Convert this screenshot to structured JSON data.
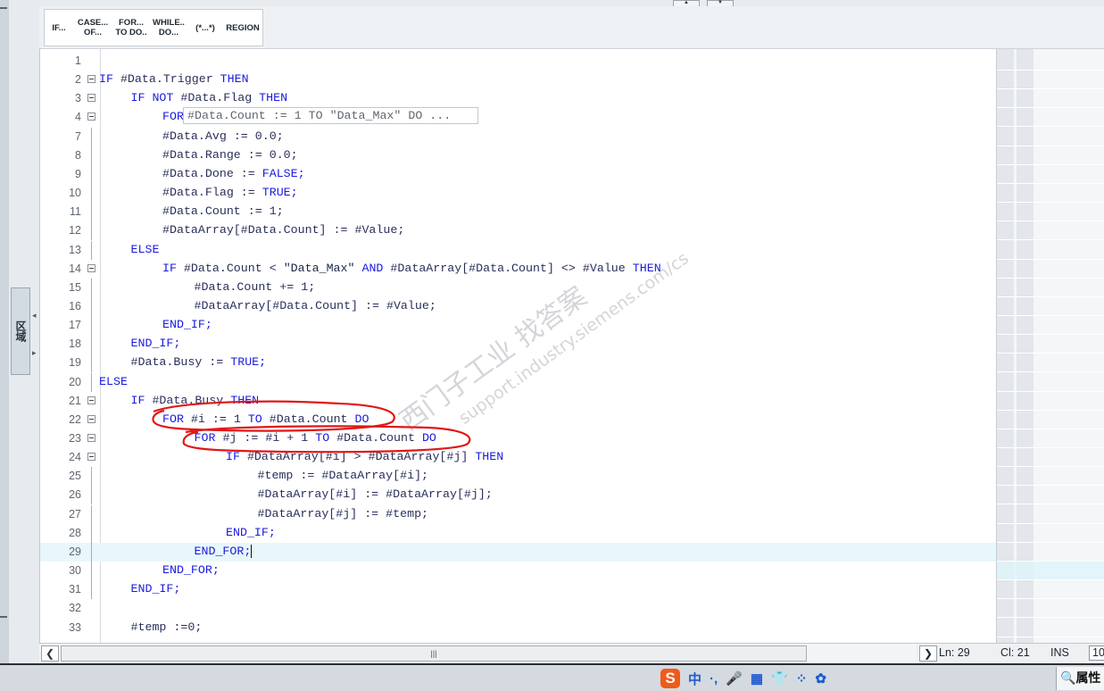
{
  "toolbar": {
    "buttons": [
      {
        "label": "IF..."
      },
      {
        "label": "CASE...\nOF..."
      },
      {
        "label": "FOR...\nTO DO.."
      },
      {
        "label": "WHILE..\nDO..."
      },
      {
        "label": "(*...*)"
      },
      {
        "label": "REGION"
      }
    ]
  },
  "side_panel": {
    "tab_label": "区域"
  },
  "editor": {
    "ghost_text": "#Data.Count := 1 TO \"Data_Max\" DO ...",
    "current_line": 29,
    "lines": [
      {
        "n": "1",
        "indent": 0,
        "code": ""
      },
      {
        "n": "2",
        "indent": 0,
        "code": "IF #Data.Trigger THEN"
      },
      {
        "n": "3",
        "indent": 1,
        "code": "IF NOT #Data.Flag THEN"
      },
      {
        "n": "4",
        "indent": 2,
        "code": "FOR"
      },
      {
        "n": "7",
        "indent": 2,
        "code": "#Data.Avg := 0.0;"
      },
      {
        "n": "8",
        "indent": 2,
        "code": "#Data.Range := 0.0;"
      },
      {
        "n": "9",
        "indent": 2,
        "code": "#Data.Done := FALSE;"
      },
      {
        "n": "10",
        "indent": 2,
        "code": "#Data.Flag := TRUE;"
      },
      {
        "n": "11",
        "indent": 2,
        "code": "#Data.Count := 1;"
      },
      {
        "n": "12",
        "indent": 2,
        "code": "#DataArray[#Data.Count] := #Value;"
      },
      {
        "n": "13",
        "indent": 1,
        "code": "ELSE"
      },
      {
        "n": "14",
        "indent": 2,
        "code": "IF #Data.Count < \"Data_Max\" AND #DataArray[#Data.Count] <> #Value THEN"
      },
      {
        "n": "15",
        "indent": 3,
        "code": "#Data.Count += 1;"
      },
      {
        "n": "16",
        "indent": 3,
        "code": "#DataArray[#Data.Count] := #Value;"
      },
      {
        "n": "17",
        "indent": 2,
        "code": "END_IF;"
      },
      {
        "n": "18",
        "indent": 1,
        "code": "END_IF;"
      },
      {
        "n": "19",
        "indent": 1,
        "code": "#Data.Busy := TRUE;"
      },
      {
        "n": "20",
        "indent": 0,
        "code": "ELSE"
      },
      {
        "n": "21",
        "indent": 1,
        "code": "IF #Data.Busy THEN"
      },
      {
        "n": "22",
        "indent": 2,
        "code": "FOR #i := 1 TO #Data.Count DO"
      },
      {
        "n": "23",
        "indent": 3,
        "code": "FOR #j := #i + 1 TO #Data.Count DO"
      },
      {
        "n": "24",
        "indent": 4,
        "code": "IF #DataArray[#i] > #DataArray[#j] THEN"
      },
      {
        "n": "25",
        "indent": 5,
        "code": "#temp := #DataArray[#i];"
      },
      {
        "n": "26",
        "indent": 5,
        "code": "#DataArray[#i] := #DataArray[#j];"
      },
      {
        "n": "27",
        "indent": 5,
        "code": "#DataArray[#j] := #temp;"
      },
      {
        "n": "28",
        "indent": 4,
        "code": "END_IF;"
      },
      {
        "n": "29",
        "indent": 3,
        "code": "END_FOR;"
      },
      {
        "n": "30",
        "indent": 2,
        "code": "END_FOR;"
      },
      {
        "n": "31",
        "indent": 1,
        "code": "END_IF;"
      },
      {
        "n": "32",
        "indent": 0,
        "code": ""
      },
      {
        "n": "33",
        "indent": 1,
        "code": "#temp :=0;"
      }
    ]
  },
  "scrollbar": {
    "thumb_grip": "|||"
  },
  "status": {
    "ln": "Ln: 29",
    "col": "Cl: 21",
    "mode": "INS",
    "zoom": "10"
  },
  "watermark": {
    "cn": "西门子工业 找答案",
    "url": "support.industry.siemens.com/cs"
  },
  "taskbar": {
    "ime_items": [
      "中",
      "·,",
      "🎤",
      "▦",
      "👕",
      "⁘",
      "✿"
    ],
    "properties_label": "属性"
  },
  "colors": {
    "keyword": "#1a1adf",
    "annotation": "#e01818",
    "current_line": "#e8f7fb"
  }
}
